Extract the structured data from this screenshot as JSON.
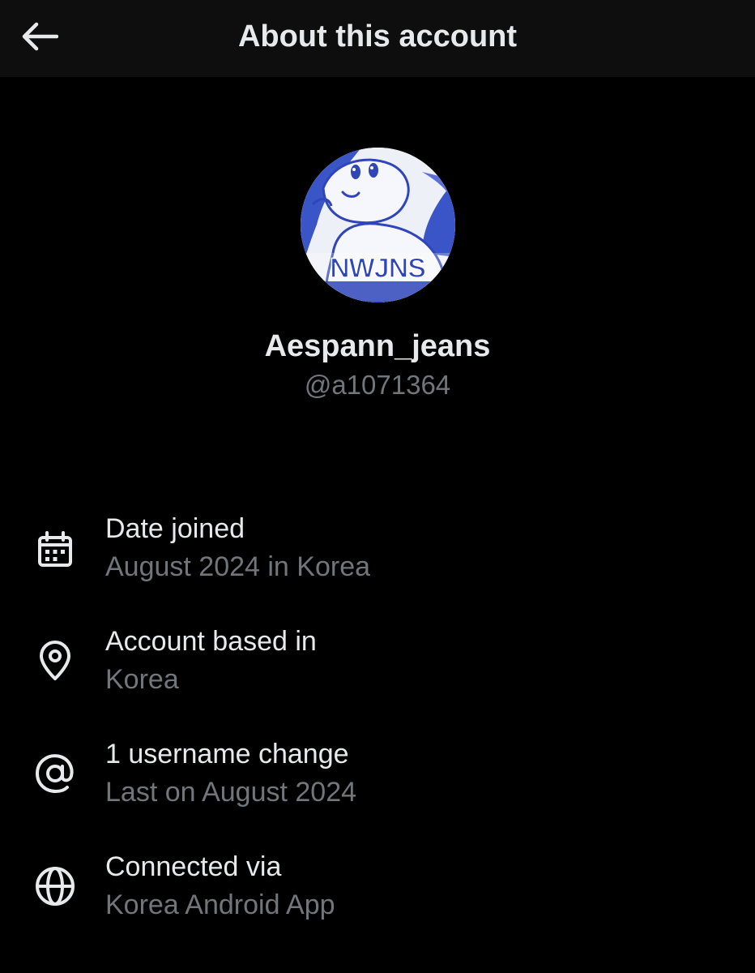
{
  "header": {
    "title": "About this account",
    "back_icon": "arrow-left-icon"
  },
  "profile": {
    "display_name": "Aespann_jeans",
    "handle": "@a1071364",
    "avatar_text": "NWJNS"
  },
  "details": [
    {
      "icon": "calendar-icon",
      "title": "Date joined",
      "value": "August 2024 in Korea"
    },
    {
      "icon": "location-pin-icon",
      "title": "Account based in",
      "value": "Korea"
    },
    {
      "icon": "at-sign-icon",
      "title": "1 username change",
      "value": "Last on August 2024"
    },
    {
      "icon": "globe-icon",
      "title": "Connected via",
      "value": "Korea Android App"
    }
  ],
  "colors": {
    "background": "#000000",
    "header_background": "#0e0e0e",
    "primary_text": "#e7e9ea",
    "secondary_text": "#71767b",
    "avatar_accent": "#2f45b8"
  }
}
